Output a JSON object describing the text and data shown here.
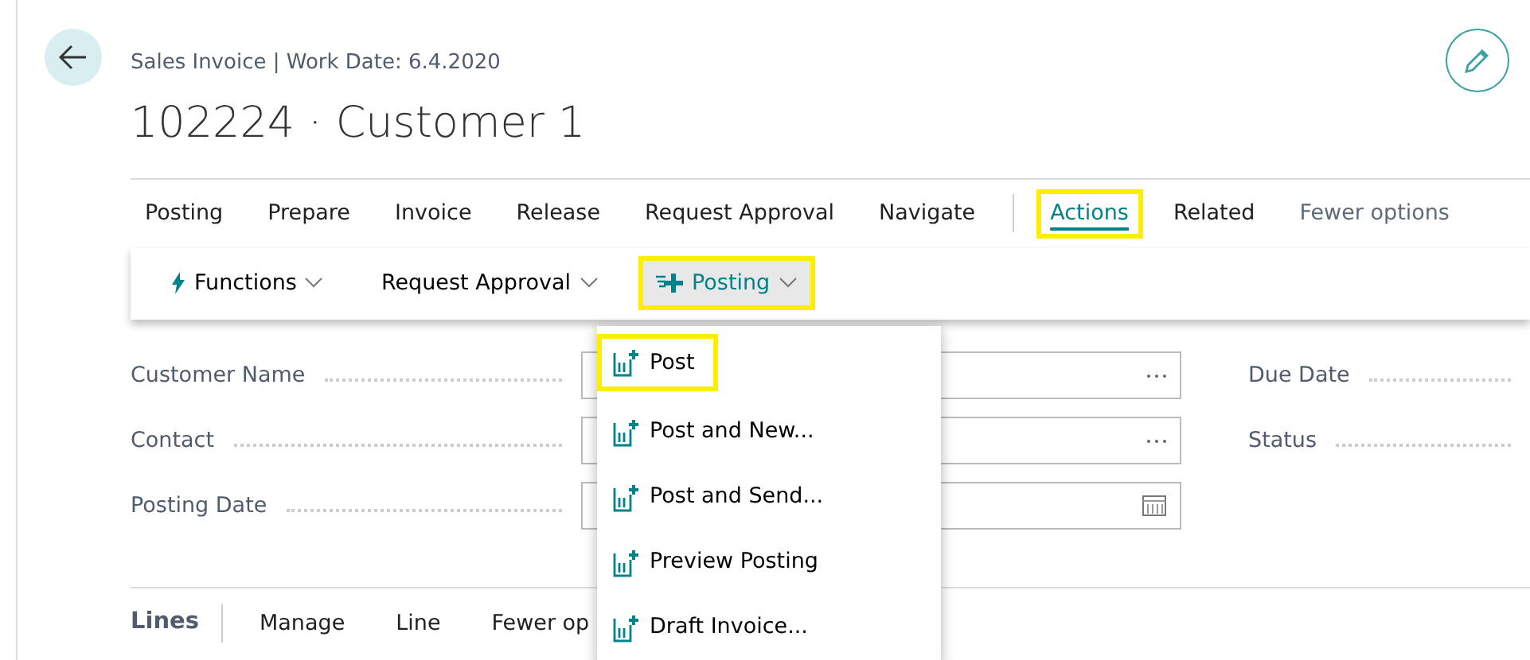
{
  "header": {
    "caption": "Sales Invoice | Work Date: 6.4.2020",
    "title": "102224 · Customer 1"
  },
  "tabs": [
    {
      "label": "Posting",
      "selected": false,
      "highlighted": false,
      "kind": "tab"
    },
    {
      "label": "Prepare",
      "selected": false,
      "highlighted": false,
      "kind": "tab"
    },
    {
      "label": "Invoice",
      "selected": false,
      "highlighted": false,
      "kind": "tab"
    },
    {
      "label": "Release",
      "selected": false,
      "highlighted": false,
      "kind": "tab"
    },
    {
      "label": "Request Approval",
      "selected": false,
      "highlighted": false,
      "kind": "tab"
    },
    {
      "label": "Navigate",
      "selected": false,
      "highlighted": false,
      "kind": "tab"
    },
    {
      "label": "Actions",
      "selected": true,
      "highlighted": true,
      "kind": "tab"
    },
    {
      "label": "Related",
      "selected": false,
      "highlighted": false,
      "kind": "tab"
    },
    {
      "label": "Fewer options",
      "selected": false,
      "highlighted": false,
      "kind": "toggle"
    }
  ],
  "action_bar": [
    {
      "label": "Functions",
      "expanded": false,
      "highlighted": false
    },
    {
      "label": "Request Approval",
      "expanded": false,
      "highlighted": false
    },
    {
      "label": "Posting",
      "expanded": true,
      "highlighted": true
    }
  ],
  "menu": [
    {
      "label": "Post",
      "highlighted": true
    },
    {
      "label": "Post and New...",
      "highlighted": false
    },
    {
      "label": "Post and Send...",
      "highlighted": false
    },
    {
      "label": "Preview Posting",
      "highlighted": false
    },
    {
      "label": "Draft Invoice...",
      "highlighted": false
    }
  ],
  "fields": [
    {
      "label": "Customer Name",
      "kind": "lookup"
    },
    {
      "label": "Contact",
      "kind": "lookup"
    },
    {
      "label": "Posting Date",
      "kind": "date"
    }
  ],
  "side_fields": [
    {
      "label": "Due Date"
    },
    {
      "label": "Status"
    }
  ],
  "lines": {
    "title": "Lines",
    "actions": [
      "Manage",
      "Line",
      "Fewer op"
    ]
  }
}
